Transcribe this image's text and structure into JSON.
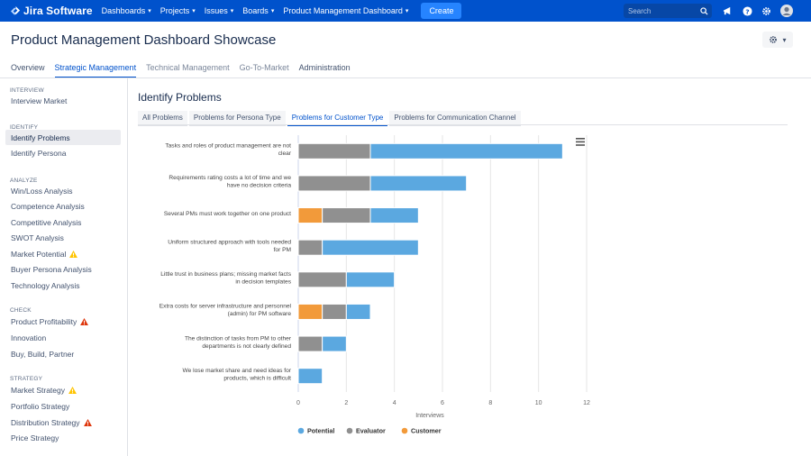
{
  "nav": {
    "brand": "Jira Software",
    "items": [
      {
        "label": "Dashboards",
        "name": "nav-dashboards"
      },
      {
        "label": "Projects",
        "name": "nav-projects"
      },
      {
        "label": "Issues",
        "name": "nav-issues"
      },
      {
        "label": "Boards",
        "name": "nav-boards"
      },
      {
        "label": "Product Management Dashboard",
        "name": "nav-product-management-dashboard"
      }
    ],
    "create_label": "Create",
    "search_placeholder": "Search"
  },
  "page": {
    "title": "Product Management Dashboard Showcase",
    "tabs": [
      "Overview",
      "Strategic Management",
      "Technical Management",
      "Go-To-Market",
      "Administration"
    ],
    "active_tab": "Strategic Management"
  },
  "sidebar": {
    "sections": [
      {
        "label": "INTERVIEW",
        "items": [
          {
            "label": "Interview Market",
            "warn": ""
          }
        ]
      },
      {
        "label": "IDENTIFY",
        "items": [
          {
            "label": "Identify Problems",
            "warn": "",
            "active": true
          },
          {
            "label": "Identify Persona",
            "warn": ""
          }
        ]
      },
      {
        "label": "ANALYZE",
        "items": [
          {
            "label": "Win/Loss Analysis",
            "warn": ""
          },
          {
            "label": "Competence Analysis",
            "warn": ""
          },
          {
            "label": "Competitive Analysis",
            "warn": ""
          },
          {
            "label": "SWOT Analysis",
            "warn": ""
          },
          {
            "label": "Market Potential",
            "warn": "yellow"
          },
          {
            "label": "Buyer Persona Analysis",
            "warn": ""
          },
          {
            "label": "Technology Analysis",
            "warn": ""
          }
        ]
      },
      {
        "label": "CHECK",
        "items": [
          {
            "label": "Product Profitability",
            "warn": "red"
          },
          {
            "label": "Innovation",
            "warn": ""
          },
          {
            "label": "Buy, Build, Partner",
            "warn": ""
          }
        ]
      },
      {
        "label": "STRATEGY",
        "items": [
          {
            "label": "Market Strategy",
            "warn": "yellow"
          },
          {
            "label": "Portfolio Strategy",
            "warn": ""
          },
          {
            "label": "Distribution Strategy",
            "warn": "red"
          },
          {
            "label": "Price Strategy",
            "warn": ""
          }
        ]
      }
    ]
  },
  "main": {
    "title": "Identify Problems",
    "subtabs": [
      "All Problems",
      "Problems for Persona Type",
      "Problems for Customer Type",
      "Problems for Communication Channel"
    ],
    "active_subtab": "Problems for Customer Type"
  },
  "colors": {
    "potential": "#5ba8e0",
    "evaluator": "#909090",
    "customer": "#f29a3a",
    "warn_yellow": "#ffc400",
    "warn_red": "#de350b"
  },
  "chart_data": {
    "type": "bar",
    "orientation": "horizontal",
    "stacked": true,
    "categories": [
      [
        "Tasks and roles of product management are not",
        "clear"
      ],
      [
        "Requirements rating costs a lot of time and we",
        "have no decision criteria"
      ],
      [
        "Several PMs must work together on one product"
      ],
      [
        "Uniform structured approach with tools needed",
        "for PM"
      ],
      [
        "Little trust in business plans; missing market facts",
        "in decision templates"
      ],
      [
        "Extra costs for server infrastructure and personnel",
        "(admin) for PM software"
      ],
      [
        "The distinction of tasks from PM to other",
        "departments is not clearly defined"
      ],
      [
        "We lose market share and need ideas for",
        "products, which is difficult"
      ]
    ],
    "series": [
      {
        "name": "Customer",
        "color": "#f29a3a",
        "values": [
          0,
          0,
          1,
          0,
          0,
          1,
          0,
          0
        ]
      },
      {
        "name": "Evaluator",
        "color": "#909090",
        "values": [
          3,
          3,
          2,
          1,
          2,
          1,
          1,
          0
        ]
      },
      {
        "name": "Potential",
        "color": "#5ba8e0",
        "values": [
          8,
          4,
          2,
          4,
          2,
          1,
          1,
          1
        ]
      }
    ],
    "legend_order": [
      "Potential",
      "Evaluator",
      "Customer"
    ],
    "xlabel": "Interviews",
    "xticks": [
      0,
      2,
      4,
      6,
      8,
      10,
      12
    ],
    "xlim": [
      0,
      12
    ],
    "grid": true,
    "legend_position": "bottom"
  }
}
